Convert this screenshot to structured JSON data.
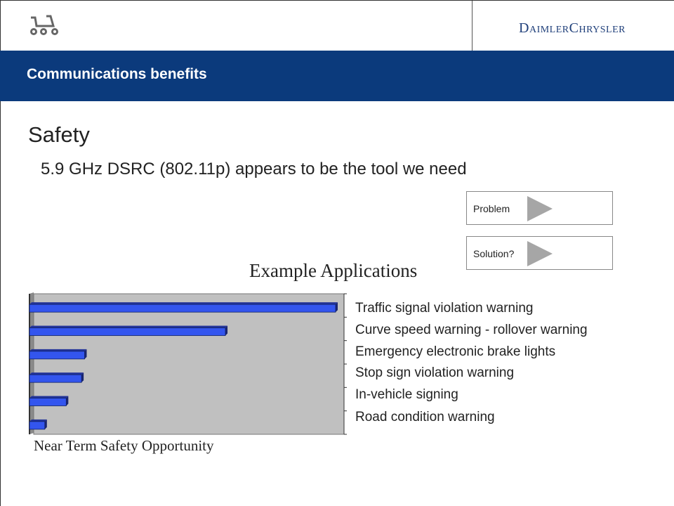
{
  "header": {
    "brand": "DaimlerChrysler",
    "logo_icon": "car-wheels-icon"
  },
  "banner": {
    "title": "Communications benefits"
  },
  "main": {
    "section_title": "Safety",
    "subtitle": "5.9 GHz DSRC (802.11p) appears to be the tool we need"
  },
  "side_buttons": [
    {
      "label": "Problem",
      "icon": "play-arrow-icon"
    },
    {
      "label": "Solution?",
      "icon": "play-arrow-icon"
    }
  ],
  "chart_data": {
    "type": "bar",
    "orientation": "horizontal",
    "title": "Example Applications",
    "xlabel": "Near Term Safety Opportunity",
    "categories": [
      "Traffic signal violation warning",
      "Curve speed warning - rollover warning",
      "Emergency electronic brake lights",
      "Stop sign violation warning",
      "In-vehicle signing",
      "Road condition warning"
    ],
    "values": [
      100,
      64,
      18,
      17,
      12,
      5
    ],
    "xlim": [
      0,
      100
    ],
    "bar_color": "#3355ee",
    "background_color": "#c0c0c0",
    "grid": false,
    "legend": "none"
  }
}
